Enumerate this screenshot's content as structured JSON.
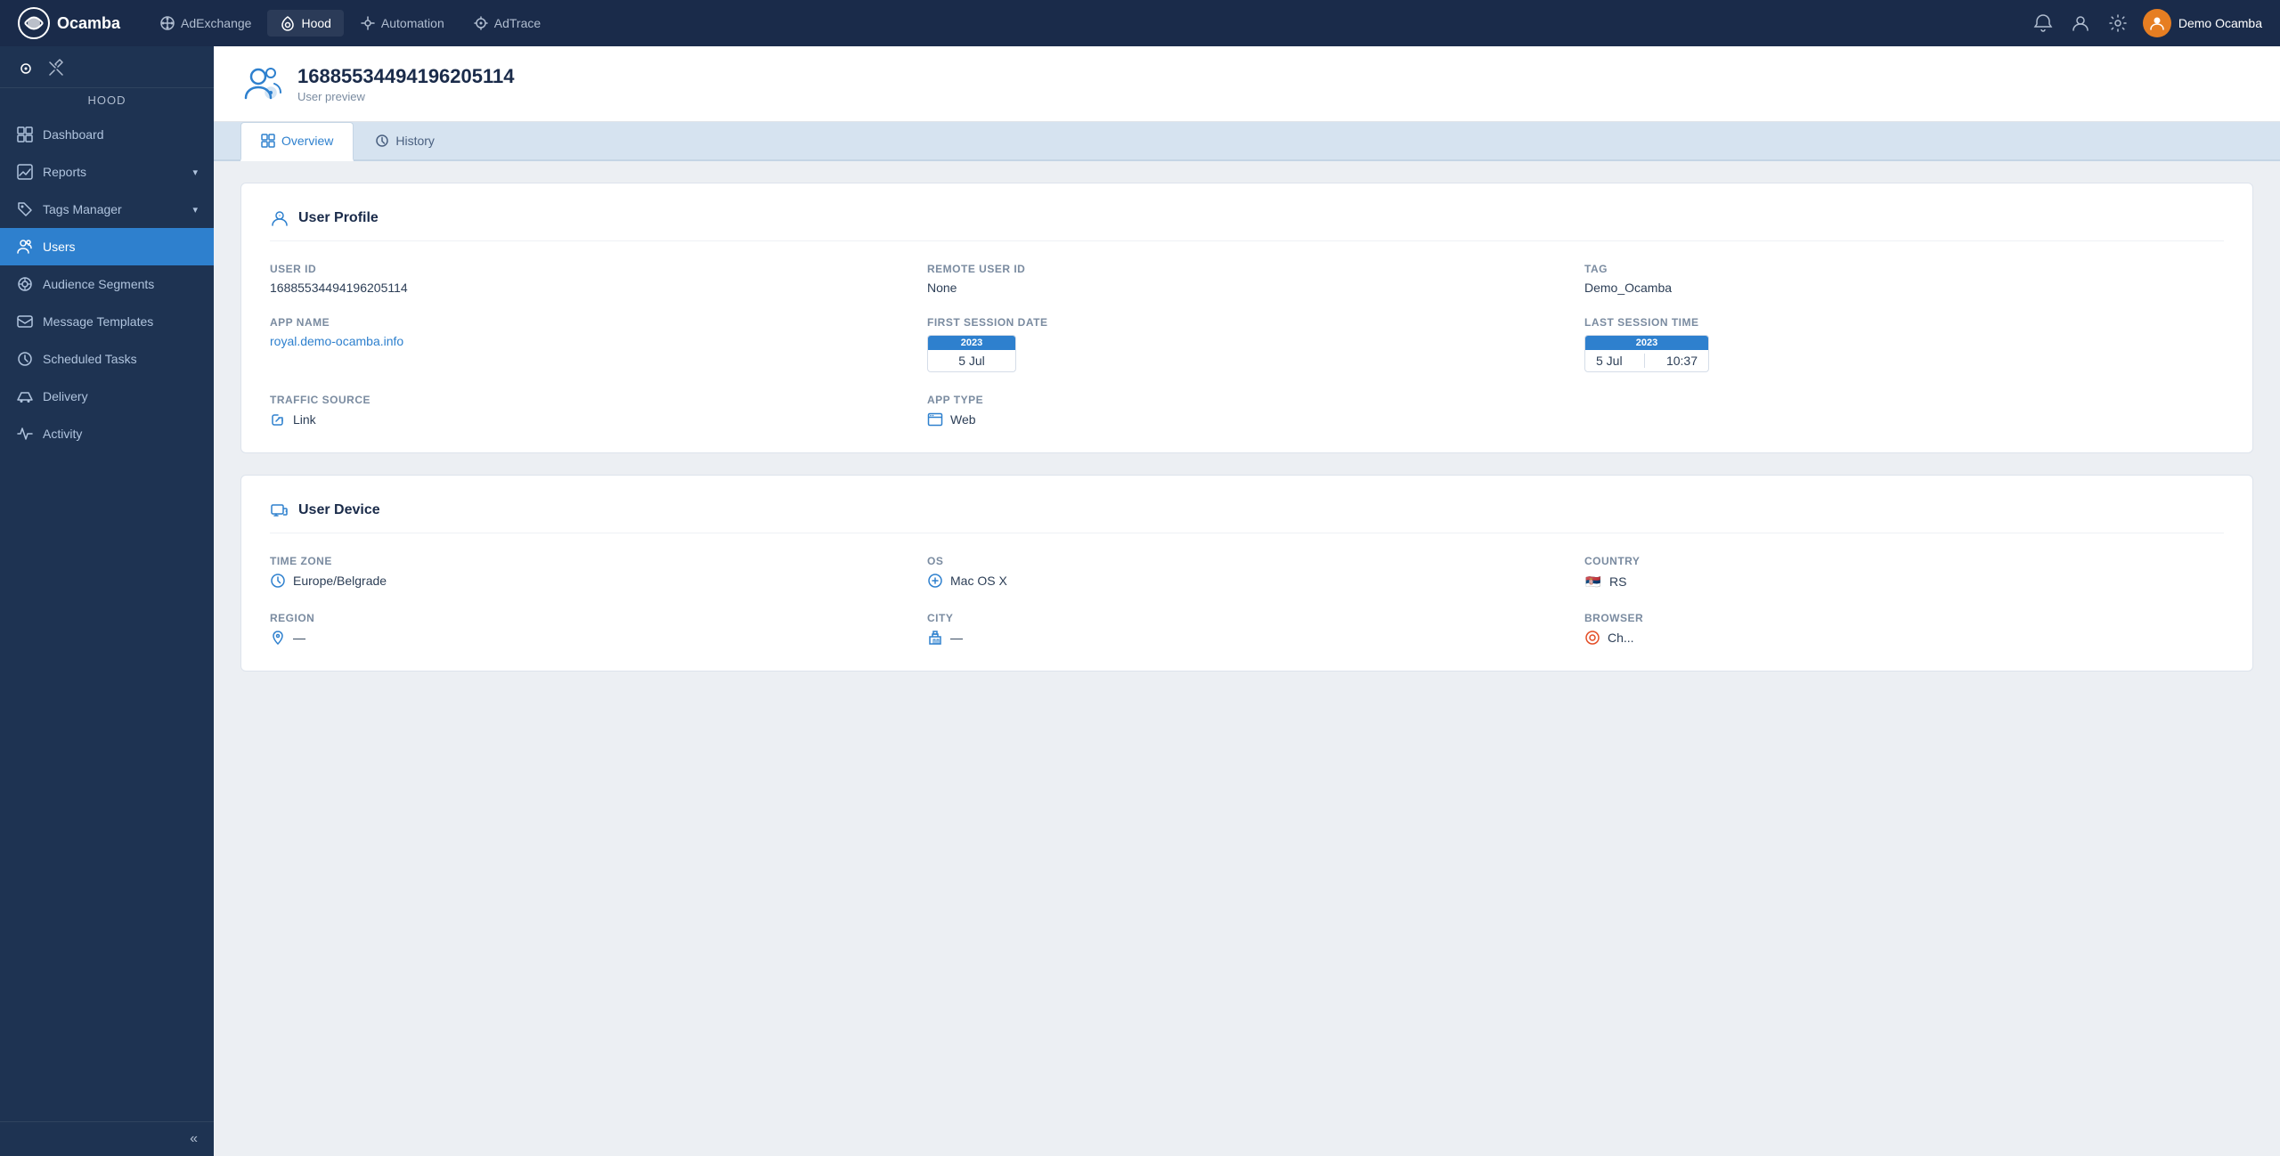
{
  "app": {
    "name": "Ocamba"
  },
  "topnav": {
    "items": [
      {
        "id": "adexchange",
        "label": "AdExchange",
        "active": false
      },
      {
        "id": "hood",
        "label": "Hood",
        "active": true
      },
      {
        "id": "automation",
        "label": "Automation",
        "active": false
      },
      {
        "id": "adtrace",
        "label": "AdTrace",
        "active": false
      }
    ],
    "user_name": "Demo Ocamba"
  },
  "sidebar": {
    "section_label": "Hood",
    "items": [
      {
        "id": "dashboard",
        "label": "Dashboard",
        "active": false,
        "has_arrow": false
      },
      {
        "id": "reports",
        "label": "Reports",
        "active": false,
        "has_arrow": true
      },
      {
        "id": "tags-manager",
        "label": "Tags Manager",
        "active": false,
        "has_arrow": true
      },
      {
        "id": "users",
        "label": "Users",
        "active": true,
        "has_arrow": false
      },
      {
        "id": "audience-segments",
        "label": "Audience Segments",
        "active": false,
        "has_arrow": false
      },
      {
        "id": "message-templates",
        "label": "Message Templates",
        "active": false,
        "has_arrow": false
      },
      {
        "id": "scheduled-tasks",
        "label": "Scheduled Tasks",
        "active": false,
        "has_arrow": false
      },
      {
        "id": "delivery",
        "label": "Delivery",
        "active": false,
        "has_arrow": false
      },
      {
        "id": "activity",
        "label": "Activity",
        "active": false,
        "has_arrow": false
      }
    ]
  },
  "page": {
    "user_id": "16885534494196205114",
    "subtitle": "User preview",
    "tabs": [
      {
        "id": "overview",
        "label": "Overview",
        "active": true
      },
      {
        "id": "history",
        "label": "History",
        "active": false
      }
    ]
  },
  "user_profile": {
    "section_title": "User Profile",
    "fields": {
      "user_id_label": "User ID",
      "user_id_value": "16885534494196205114",
      "remote_user_id_label": "Remote User ID",
      "remote_user_id_value": "None",
      "tag_label": "Tag",
      "tag_value": "Demo_Ocamba",
      "app_name_label": "App name",
      "app_name_value": "royal.demo-ocamba.info",
      "first_session_label": "First Session Date",
      "first_session_year": "2023",
      "first_session_day": "5 Jul",
      "last_session_label": "Last Session Time",
      "last_session_year": "2023",
      "last_session_day": "5 Jul",
      "last_session_time": "10:37",
      "traffic_source_label": "Traffic Source",
      "traffic_source_value": "Link",
      "app_type_label": "App Type",
      "app_type_value": "Web"
    }
  },
  "user_device": {
    "section_title": "User Device",
    "fields": {
      "timezone_label": "Time Zone",
      "timezone_value": "Europe/Belgrade",
      "os_label": "OS",
      "os_value": "Mac OS X",
      "country_label": "Country",
      "country_value": "RS",
      "region_label": "Region",
      "city_label": "City",
      "browser_label": "Browser"
    }
  }
}
